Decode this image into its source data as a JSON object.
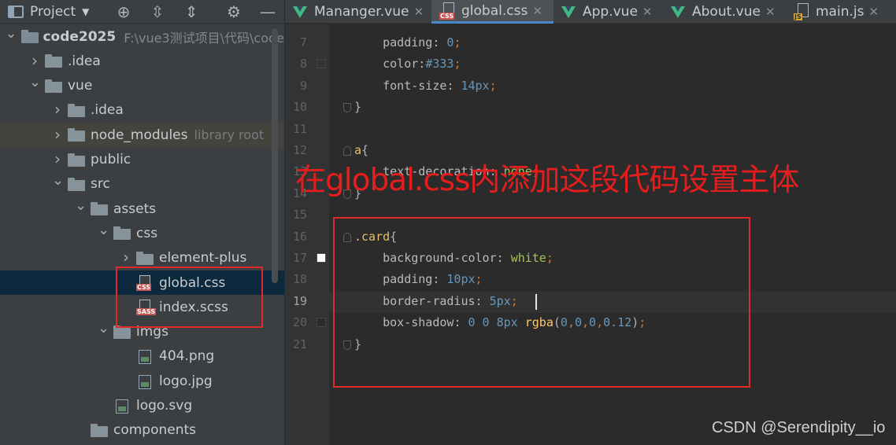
{
  "project_panel": {
    "title": "Project",
    "toolbar_icons": [
      "locate-icon",
      "expand-all-icon",
      "collapse-all-icon",
      "gear-icon",
      "hide-icon"
    ],
    "tree": [
      {
        "label": "code2025",
        "path": "F:\\vue3测试项目\\代码\\code",
        "depth": 0,
        "expanded": true,
        "icon": "module-folder-icon",
        "bold": true
      },
      {
        "label": ".idea",
        "depth": 1,
        "expanded": false,
        "icon": "folder-icon"
      },
      {
        "label": "vue",
        "depth": 1,
        "expanded": true,
        "icon": "folder-icon"
      },
      {
        "label": ".idea",
        "depth": 2,
        "expanded": false,
        "icon": "folder-icon"
      },
      {
        "label": "node_modules",
        "tag": "library root",
        "depth": 2,
        "expanded": false,
        "icon": "folder-icon"
      },
      {
        "label": "public",
        "depth": 2,
        "expanded": false,
        "icon": "folder-icon"
      },
      {
        "label": "src",
        "depth": 2,
        "expanded": true,
        "icon": "folder-icon"
      },
      {
        "label": "assets",
        "depth": 3,
        "expanded": true,
        "icon": "folder-icon"
      },
      {
        "label": "css",
        "depth": 4,
        "expanded": true,
        "icon": "folder-icon"
      },
      {
        "label": "element-plus",
        "depth": 5,
        "expanded": false,
        "icon": "folder-icon"
      },
      {
        "label": "global.css",
        "depth": 5,
        "icon": "css-file-icon",
        "badge": "CSS",
        "selected": true
      },
      {
        "label": "index.scss",
        "depth": 5,
        "icon": "sass-file-icon",
        "badge": "SASS"
      },
      {
        "label": "imgs",
        "depth": 4,
        "expanded": true,
        "icon": "folder-icon"
      },
      {
        "label": "404.png",
        "depth": 5,
        "icon": "image-file-icon"
      },
      {
        "label": "logo.jpg",
        "depth": 5,
        "icon": "image-file-icon"
      },
      {
        "label": "logo.svg",
        "depth": 4,
        "icon": "image-file-icon"
      },
      {
        "label": "components",
        "depth": 3,
        "icon": "folder-icon"
      }
    ]
  },
  "editor_tabs": [
    {
      "label": "Mananger.vue",
      "icon": "vue-icon",
      "active": false
    },
    {
      "label": "global.css",
      "icon": "css-file-icon",
      "badge": "CSS",
      "active": true
    },
    {
      "label": "App.vue",
      "icon": "vue-icon",
      "active": false
    },
    {
      "label": "About.vue",
      "icon": "vue-icon",
      "active": false
    },
    {
      "label": "main.js",
      "icon": "js-file-icon",
      "badge": "JS",
      "active": false
    }
  ],
  "editor": {
    "current_line": 19,
    "lines": [
      {
        "n": 7,
        "tokens": [
          [
            "prop",
            "    padding"
          ],
          [
            "plain",
            ": "
          ],
          [
            "num",
            "0"
          ],
          [
            "punc",
            ";"
          ]
        ]
      },
      {
        "n": 8,
        "swatch": "#333333",
        "tokens": [
          [
            "prop",
            "    color"
          ],
          [
            "plain",
            ":"
          ],
          [
            "num",
            "#333"
          ],
          [
            "punc",
            ";"
          ]
        ]
      },
      {
        "n": 9,
        "tokens": [
          [
            "prop",
            "    font-size"
          ],
          [
            "plain",
            ": "
          ],
          [
            "num",
            "14px"
          ],
          [
            "punc",
            ";"
          ]
        ]
      },
      {
        "n": 10,
        "fold": "end",
        "tokens": [
          [
            "plain",
            "}"
          ]
        ]
      },
      {
        "n": 11,
        "tokens": []
      },
      {
        "n": 12,
        "fold": "start",
        "tokens": [
          [
            "sel",
            "a"
          ],
          [
            "plain",
            "{"
          ]
        ]
      },
      {
        "n": 13,
        "tokens": [
          [
            "prop",
            "    text-decoration"
          ],
          [
            "plain",
            ": "
          ],
          [
            "val",
            "none"
          ],
          [
            "punc",
            ";"
          ]
        ]
      },
      {
        "n": 14,
        "fold": "end",
        "tokens": [
          [
            "plain",
            "}"
          ]
        ]
      },
      {
        "n": 15,
        "tokens": []
      },
      {
        "n": 16,
        "fold": "start",
        "tokens": [
          [
            "sel",
            ".card"
          ],
          [
            "plain",
            "{"
          ]
        ]
      },
      {
        "n": 17,
        "swatch": "#ffffff",
        "tokens": [
          [
            "prop",
            "    background-color"
          ],
          [
            "plain",
            ": "
          ],
          [
            "val",
            "white"
          ],
          [
            "punc",
            ";"
          ]
        ]
      },
      {
        "n": 18,
        "tokens": [
          [
            "prop",
            "    padding"
          ],
          [
            "plain",
            ": "
          ],
          [
            "num",
            "10px"
          ],
          [
            "punc",
            ";"
          ]
        ]
      },
      {
        "n": 19,
        "tokens": [
          [
            "prop",
            "    border-radius"
          ],
          [
            "plain",
            ": "
          ],
          [
            "num",
            "5px"
          ],
          [
            "punc",
            ";"
          ]
        ]
      },
      {
        "n": 20,
        "swatch": "#2b2b2b",
        "tokens": [
          [
            "prop",
            "    box-shadow"
          ],
          [
            "plain",
            ": "
          ],
          [
            "num",
            "0 0 8px "
          ],
          [
            "fn",
            "rgba"
          ],
          [
            "plain",
            "("
          ],
          [
            "num",
            "0"
          ],
          [
            "punc",
            ","
          ],
          [
            "num",
            "0"
          ],
          [
            "punc",
            ","
          ],
          [
            "num",
            "0"
          ],
          [
            "punc",
            ","
          ],
          [
            "num",
            "0.12"
          ],
          [
            "plain",
            ")"
          ],
          [
            "punc",
            ";"
          ]
        ]
      },
      {
        "n": 21,
        "fold": "end",
        "tokens": [
          [
            "plain",
            "}"
          ]
        ]
      }
    ]
  },
  "annotation": {
    "text": "在global.css内添加这段代码设置主体",
    "color": "#e51d1d"
  },
  "watermark": "CSDN @Serendipity__io",
  "colors": {
    "panel_bg": "#3c3f41",
    "editor_bg": "#2b2b2b",
    "selected_row": "#0d293e",
    "accent": "#4a88c7",
    "annotation_red": "#e02a2a"
  }
}
